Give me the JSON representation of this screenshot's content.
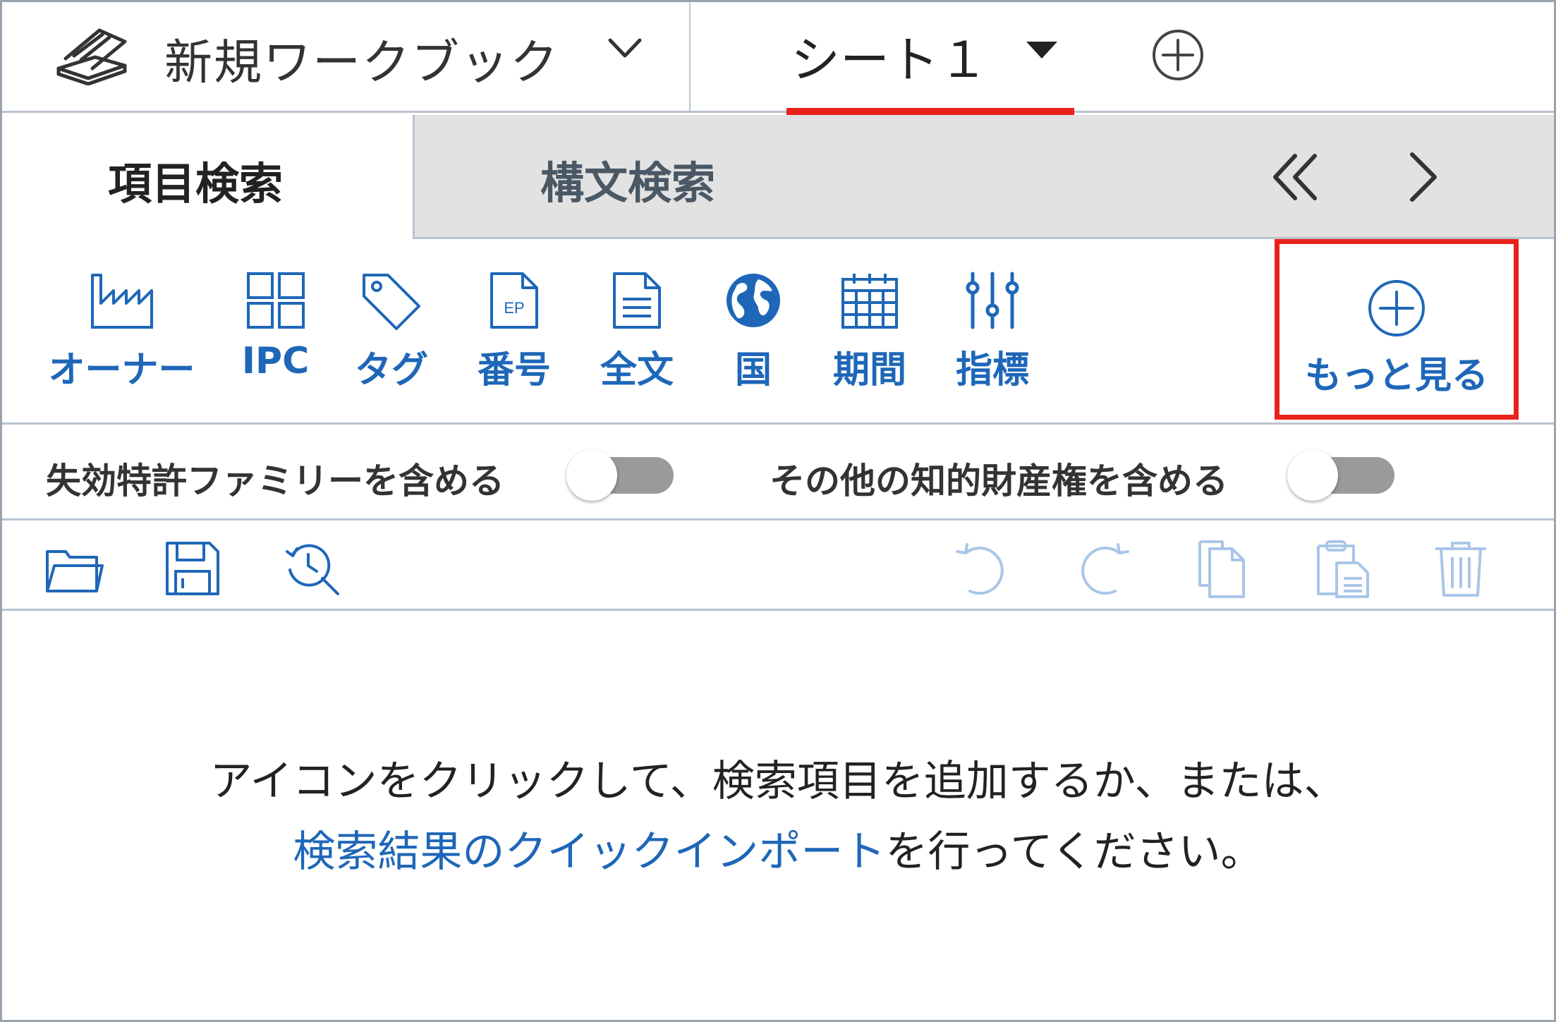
{
  "workbook": {
    "title": "新規ワークブック",
    "icon": "stacked-books-icon"
  },
  "sheet": {
    "label": "シート１",
    "active_underline_color": "#e8221b"
  },
  "search_tabs": [
    {
      "label": "項目検索",
      "active": true
    },
    {
      "label": "構文検索",
      "active": false
    }
  ],
  "icon_items": [
    {
      "label": "オーナー",
      "icon": "factory-icon"
    },
    {
      "label": "IPC",
      "icon": "grid-icon"
    },
    {
      "label": "タグ",
      "icon": "tag-icon"
    },
    {
      "label": "番号",
      "icon": "ep-document-icon",
      "icon_text": "EP"
    },
    {
      "label": "全文",
      "icon": "document-icon"
    },
    {
      "label": "国",
      "icon": "globe-icon"
    },
    {
      "label": "期間",
      "icon": "calendar-icon"
    },
    {
      "label": "指標",
      "icon": "sliders-icon"
    }
  ],
  "more": {
    "label": "もっと見る",
    "icon": "plus-circle-icon",
    "highlight_color": "#e8221b"
  },
  "toggles": [
    {
      "label": "失効特許ファミリーを含める",
      "on": false
    },
    {
      "label": "その他の知的財産権を含める",
      "on": false
    }
  ],
  "tools": [
    "folder-open-icon",
    "save-icon",
    "history-search-icon",
    "undo-icon",
    "redo-icon",
    "copy-icon",
    "paste-icon",
    "trash-icon"
  ],
  "message": {
    "line1": "アイコンをクリックして、検索項目を追加するか、または、",
    "link": "検索結果のクイックインポート",
    "line2_rest": "を行ってください。"
  },
  "colors": {
    "accent_blue": "#1e67b8",
    "border": "#b8c3cf",
    "red": "#e8221b",
    "disabled_icon": "#a9c6e8"
  }
}
